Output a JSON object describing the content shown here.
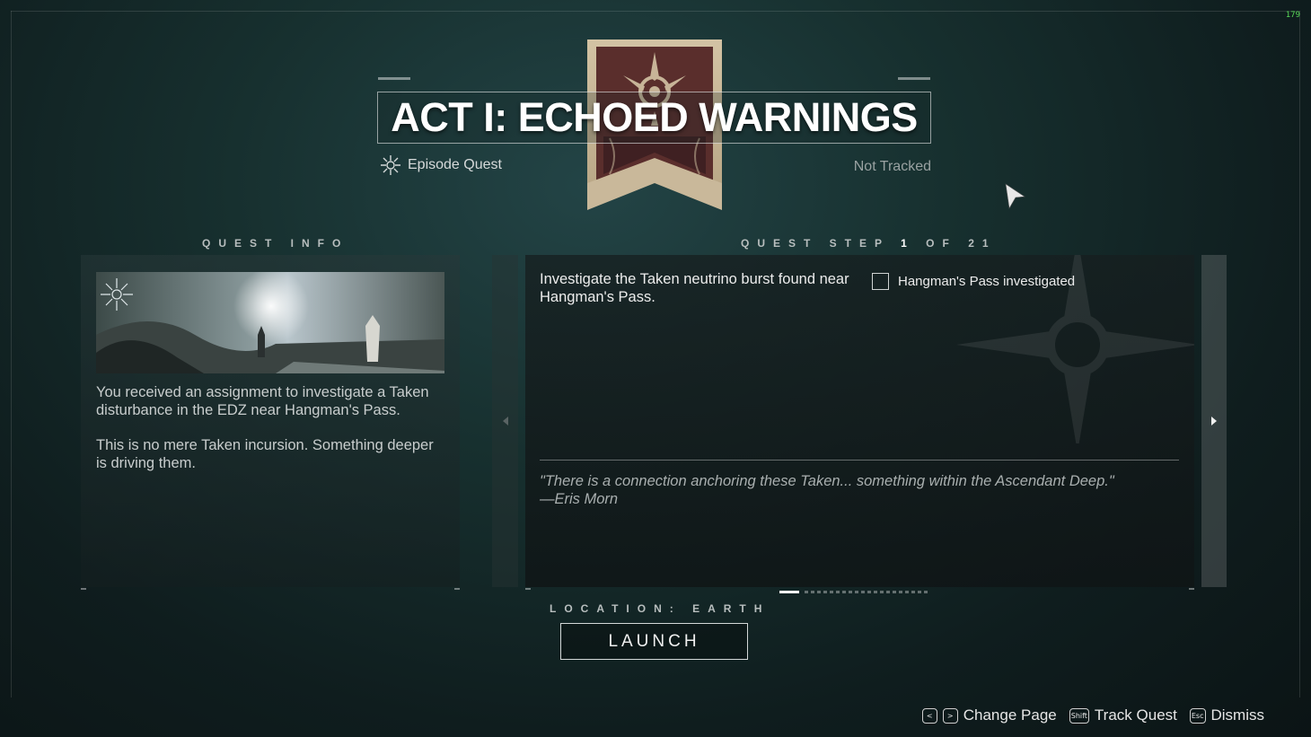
{
  "hud": {
    "fps": "179"
  },
  "header": {
    "title": "ACT I: ECHOED WARNINGS",
    "quest_type": "Episode Quest",
    "quest_type_icon": "episode-star-icon",
    "tracking_status": "Not Tracked"
  },
  "quest_info": {
    "label": "QUEST INFO",
    "image_emblem": "episode-star-icon",
    "paragraphs": [
      "You received an assignment to investigate a Taken disturbance in the EDZ near Hangman's Pass.",
      "This is no mere Taken incursion. Something deeper is driving them."
    ]
  },
  "quest_step": {
    "label_prefix": "QUEST STEP",
    "current": "1",
    "label_of": "OF",
    "total": "21",
    "description": "Investigate the Taken neutrino burst found near Hangman's Pass.",
    "objective": {
      "label": "Hangman's Pass investigated",
      "checked": false
    },
    "lore_quote": "\"There is a connection anchoring these Taken... something within the Ascendant Deep.\"",
    "lore_author": "—Eris Morn",
    "page_index": 1,
    "page_count": 21
  },
  "location": {
    "label": "LOCATION: EARTH"
  },
  "launch_button": {
    "label": "LAUNCH"
  },
  "footer": {
    "change_page": {
      "label": "Change Page",
      "keys": [
        "<",
        ">"
      ]
    },
    "track_quest": {
      "label": "Track Quest",
      "key": "Shift"
    },
    "dismiss": {
      "label": "Dismiss",
      "key": "Esc"
    }
  },
  "colors": {
    "background": "#17302f",
    "banner_tan": "#c9b89a",
    "banner_maroon": "#5a2e2c",
    "fps_green": "#58d858"
  }
}
